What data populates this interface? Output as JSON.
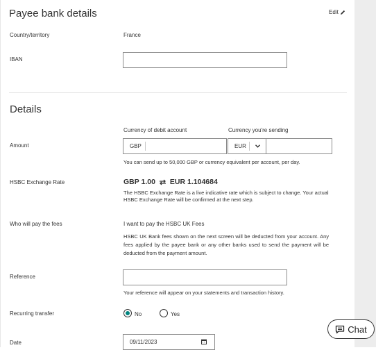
{
  "payee": {
    "title": "Payee bank details",
    "edit_label": "Edit",
    "country_label": "Country/territory",
    "country_value": "France",
    "iban_label": "IBAN",
    "iban_value": ""
  },
  "details": {
    "title": "Details",
    "debit_currency_header": "Currency of debit account",
    "sending_currency_header": "Currency you're sending",
    "amount_label": "Amount",
    "debit_currency": "GBP",
    "debit_amount": "",
    "send_currency": "EUR",
    "send_amount": "",
    "amount_hint": "You can send up to 50,000 GBP or currency equivalent per account, per day.",
    "rate_label": "HSBC Exchange Rate",
    "rate_from": "GBP 1.00",
    "rate_to": "EUR 1.104684",
    "rate_note": "The HSBC Exchange Rate is a live indicative rate which is subject to change. Your actual HSBC Exchange Rate will be confirmed at the next step.",
    "fees_label": "Who will pay the fees",
    "fees_value": "I want to pay the HSBC UK Fees",
    "fees_note": "HSBC UK Bank fees shown on the next screen will be deducted from your account. Any fees applied by the payee bank or any other banks used to send the payment will be deducted from the payment amount.",
    "reference_label": "Reference",
    "reference_value": "",
    "reference_hint": "Your reference will appear on your statements and transaction history.",
    "recurring_label": "Recurring transfer",
    "recurring_no": "No",
    "recurring_yes": "Yes",
    "date_label": "Date",
    "date_value": "09/11/2023"
  },
  "chat": {
    "label": "Chat"
  },
  "colors": {
    "accent": "#00847f",
    "border": "#8b8b8b",
    "sidebar": "#ededed"
  }
}
